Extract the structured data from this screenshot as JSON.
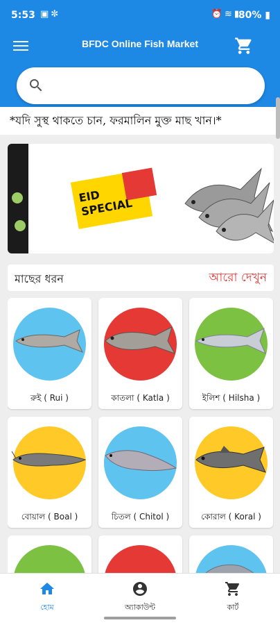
{
  "status_bar": {
    "time": "5:53",
    "battery": "80%",
    "left_icons": [
      "photo-icon",
      "settings-icon"
    ],
    "right_icons": [
      "alarm-icon",
      "wifi-icon",
      "signal-icon",
      "battery-icon"
    ]
  },
  "app_bar": {
    "title": "BFDC Online Fish Market",
    "menu_icon": "menu-icon",
    "cart_icon": "cart-icon"
  },
  "search": {
    "placeholder": "",
    "value": ""
  },
  "marquee": "*যদি সুস্থ থাকতে চান, ফরমালিন মুক্ত মাছ খান।*",
  "banner": {
    "lines": [
      "EID",
      "SPECIAL"
    ]
  },
  "section": {
    "title": "মাছের ধরন",
    "more": "আরো দেখুন"
  },
  "fish_types": [
    {
      "label": "রুই ( Rui )",
      "color": "#5ec3ef"
    },
    {
      "label": "কাতলা ( Katla )",
      "color": "#e53935"
    },
    {
      "label": "ইলিশ ( Hilsha )",
      "color": "#7cc142"
    },
    {
      "label": "বোয়াল ( Boal )",
      "color": "#ffc928"
    },
    {
      "label": "চিতল ( Chitol )",
      "color": "#5ec3ef"
    },
    {
      "label": "কোরাল ( Koral )",
      "color": "#ffc928"
    },
    {
      "label": "",
      "color": "#7cc142"
    },
    {
      "label": "",
      "color": "#e53935"
    },
    {
      "label": "",
      "color": "#5ec3ef"
    }
  ],
  "bottom_nav": {
    "items": [
      {
        "label": "হোম",
        "icon": "home-icon",
        "active": true
      },
      {
        "label": "অ্যাকাউন্ট",
        "icon": "account-icon",
        "active": false
      },
      {
        "label": "কার্ট",
        "icon": "cart-icon",
        "active": false
      }
    ]
  },
  "colors": {
    "primary": "#1e88e5",
    "accent_red": "#e53935",
    "background": "#eeeeee"
  }
}
